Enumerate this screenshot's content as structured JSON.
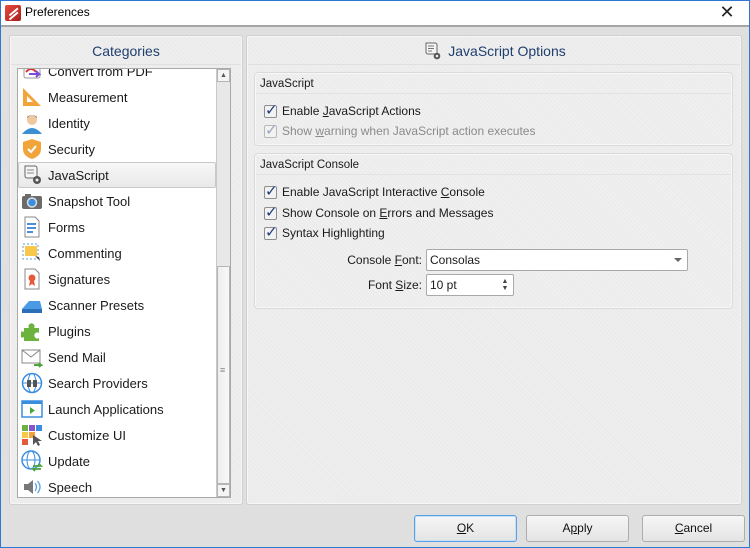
{
  "window": {
    "title": "Preferences",
    "close_label": "✕"
  },
  "left_panel": {
    "header": "Categories",
    "items": [
      {
        "label": "Convert from PDF",
        "icon": "convert-from-pdf-icon"
      },
      {
        "label": "Measurement",
        "icon": "triangle-ruler-icon"
      },
      {
        "label": "Identity",
        "icon": "person-icon"
      },
      {
        "label": "Security",
        "icon": "shield-icon"
      },
      {
        "label": "JavaScript",
        "icon": "script-gear-icon",
        "selected": true
      },
      {
        "label": "Snapshot Tool",
        "icon": "camera-icon"
      },
      {
        "label": "Forms",
        "icon": "form-document-icon"
      },
      {
        "label": "Commenting",
        "icon": "comment-note-icon"
      },
      {
        "label": "Signatures",
        "icon": "certificate-icon"
      },
      {
        "label": "Scanner Presets",
        "icon": "scanner-icon"
      },
      {
        "label": "Plugins",
        "icon": "puzzle-piece-icon"
      },
      {
        "label": "Send Mail",
        "icon": "envelope-icon"
      },
      {
        "label": "Search Providers",
        "icon": "globe-binoculars-icon"
      },
      {
        "label": "Launch Applications",
        "icon": "app-window-play-icon"
      },
      {
        "label": "Customize UI",
        "icon": "color-tiles-cursor-icon"
      },
      {
        "label": "Update",
        "icon": "globe-refresh-icon"
      },
      {
        "label": "Speech",
        "icon": "speaker-icon"
      }
    ]
  },
  "right_panel": {
    "header": "JavaScript Options",
    "groups": {
      "javascript": {
        "title": "JavaScript",
        "checks": [
          {
            "pre": "Enable ",
            "mnemonic": "J",
            "post": "avaScript Actions",
            "checked": true,
            "enabled": true
          },
          {
            "pre": "Show ",
            "mnemonic": "w",
            "post": "arning when JavaScript action executes",
            "checked": true,
            "enabled": false
          }
        ]
      },
      "console": {
        "title": "JavaScript Console",
        "checks": [
          {
            "pre": "Enable JavaScript Interactive ",
            "mnemonic": "C",
            "post": "onsole",
            "checked": true,
            "enabled": true
          },
          {
            "pre": "Show Console on ",
            "mnemonic": "E",
            "post": "rrors and Messages",
            "checked": true,
            "enabled": true
          },
          {
            "pre": "Syntax Highlighting",
            "mnemonic": "",
            "post": "",
            "checked": true,
            "enabled": true
          }
        ],
        "console_font": {
          "label_pre": "Console ",
          "label_mnemonic": "F",
          "label_post": "ont:",
          "value": "Consolas"
        },
        "font_size": {
          "label_pre": "Font ",
          "label_mnemonic": "S",
          "label_post": "ize:",
          "value": "10 pt"
        }
      }
    }
  },
  "buttons": {
    "ok": {
      "mnemonic": "O",
      "post": "K"
    },
    "apply": {
      "pre": "A",
      "mnemonic": "p",
      "post": "ply"
    },
    "cancel": {
      "mnemonic": "C",
      "post": "ancel"
    }
  }
}
